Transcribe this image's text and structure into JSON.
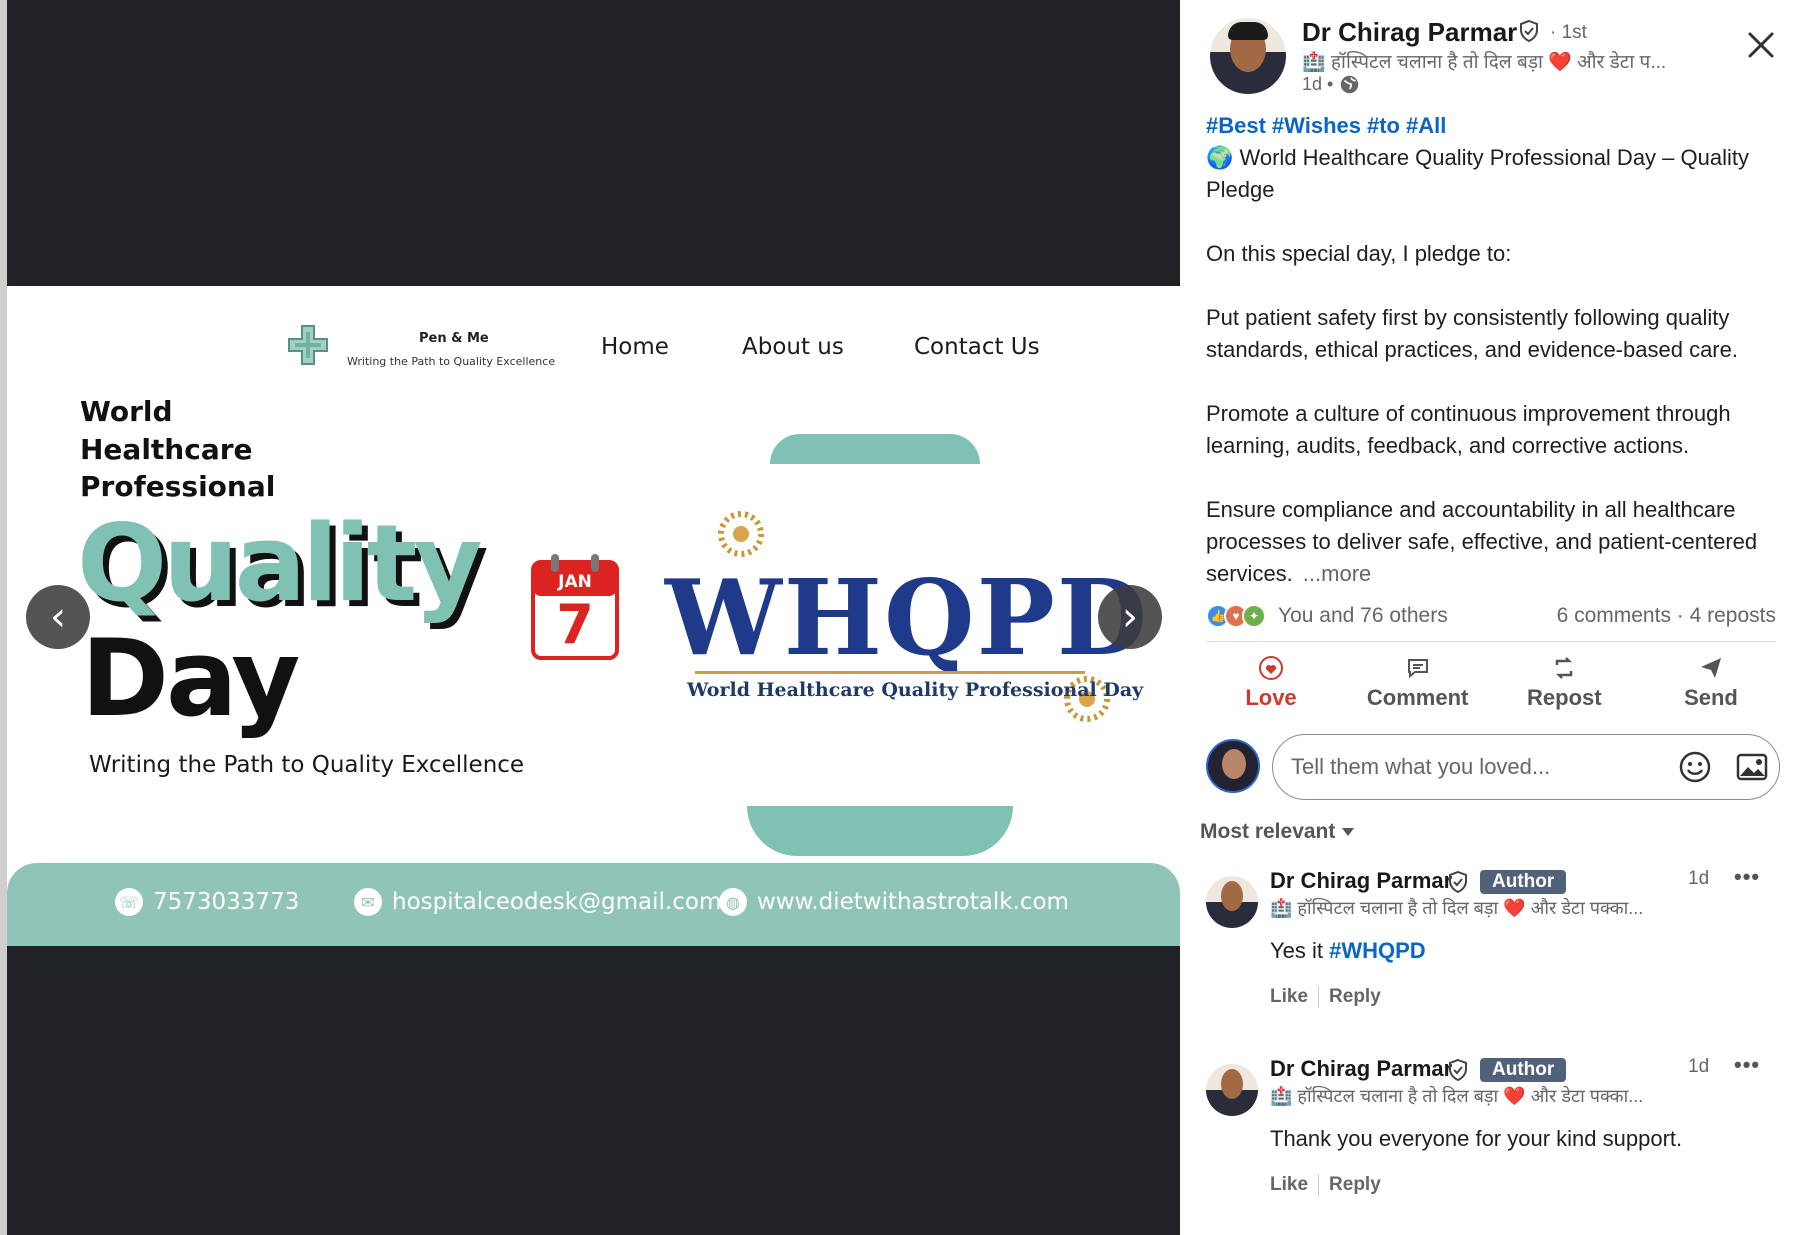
{
  "image": {
    "brand_name": "Pen & Me",
    "brand_tagline": "Writing the Path to Quality Excellence",
    "nav": [
      "Home",
      "About us",
      "Contact Us"
    ],
    "hero_lines": [
      "World",
      "Healthcare",
      "Professional"
    ],
    "hero_quality": "Quality",
    "hero_day": "Day",
    "hero_tagline": "Writing the Path to Quality Excellence",
    "calendar_month": "JAN",
    "calendar_day": "7",
    "logo_text": "WHQPD",
    "logo_subtitle": "World Healthcare Quality Professional Day",
    "phone": "7573033773",
    "email": "hospitalceodesk@gmail.com",
    "website": "www.dietwithastrotalk.com",
    "prev_arrow": "‹",
    "next_arrow": "›",
    "colors": {
      "teal": "#7fc1b2",
      "navy": "#1f3a8a",
      "bar": "#8fc4b7"
    }
  },
  "post": {
    "author_name": "Dr Chirag Parmar",
    "degree": "· 1st",
    "headline": "🏥 हॉस्पिटल चलाना है तो दिल बड़ा ❤️ और डेटा प...",
    "time": "1d •",
    "hashtags": [
      "#Best",
      "#Wishes",
      "#to",
      "#All"
    ],
    "title_line": "🌍 World Healthcare Quality Professional Day – Quality Pledge",
    "paragraphs": [
      "On this special day, I pledge to:",
      "Put patient safety first by consistently following quality standards, ethical practices, and evidence-based care.",
      "Promote a culture of continuous improvement through learning, audits, feedback, and corrective actions.",
      "Ensure compliance and accountability in all healthcare processes to deliver safe, effective, and patient-centered services."
    ],
    "more_label": "...more",
    "reactions_label": "You and 76 others",
    "counts_label": "6 comments · 4 reposts",
    "actions": {
      "love": "Love",
      "comment": "Comment",
      "repost": "Repost",
      "send": "Send"
    },
    "comment_placeholder": "Tell them what you loved...",
    "sort_label": "Most relevant"
  },
  "comments": [
    {
      "name": "Dr Chirag Parmar",
      "badge": "Author",
      "time": "1d",
      "menu": "•••",
      "headline": "🏥 हॉस्पिटल चलाना है तो दिल बड़ा ❤️ और डेटा पक्का...",
      "text_prefix": "Yes it ",
      "text_hashtag": "#WHQPD",
      "like": "Like",
      "reply": "Reply"
    },
    {
      "name": "Dr Chirag Parmar",
      "badge": "Author",
      "time": "1d",
      "menu": "•••",
      "headline": "🏥 हॉस्पिटल चलाना है तो दिल बड़ा ❤️ और डेटा पक्का...",
      "text_prefix": "Thank you everyone for your kind support.",
      "text_hashtag": "",
      "like": "Like",
      "reply": "Reply"
    }
  ]
}
